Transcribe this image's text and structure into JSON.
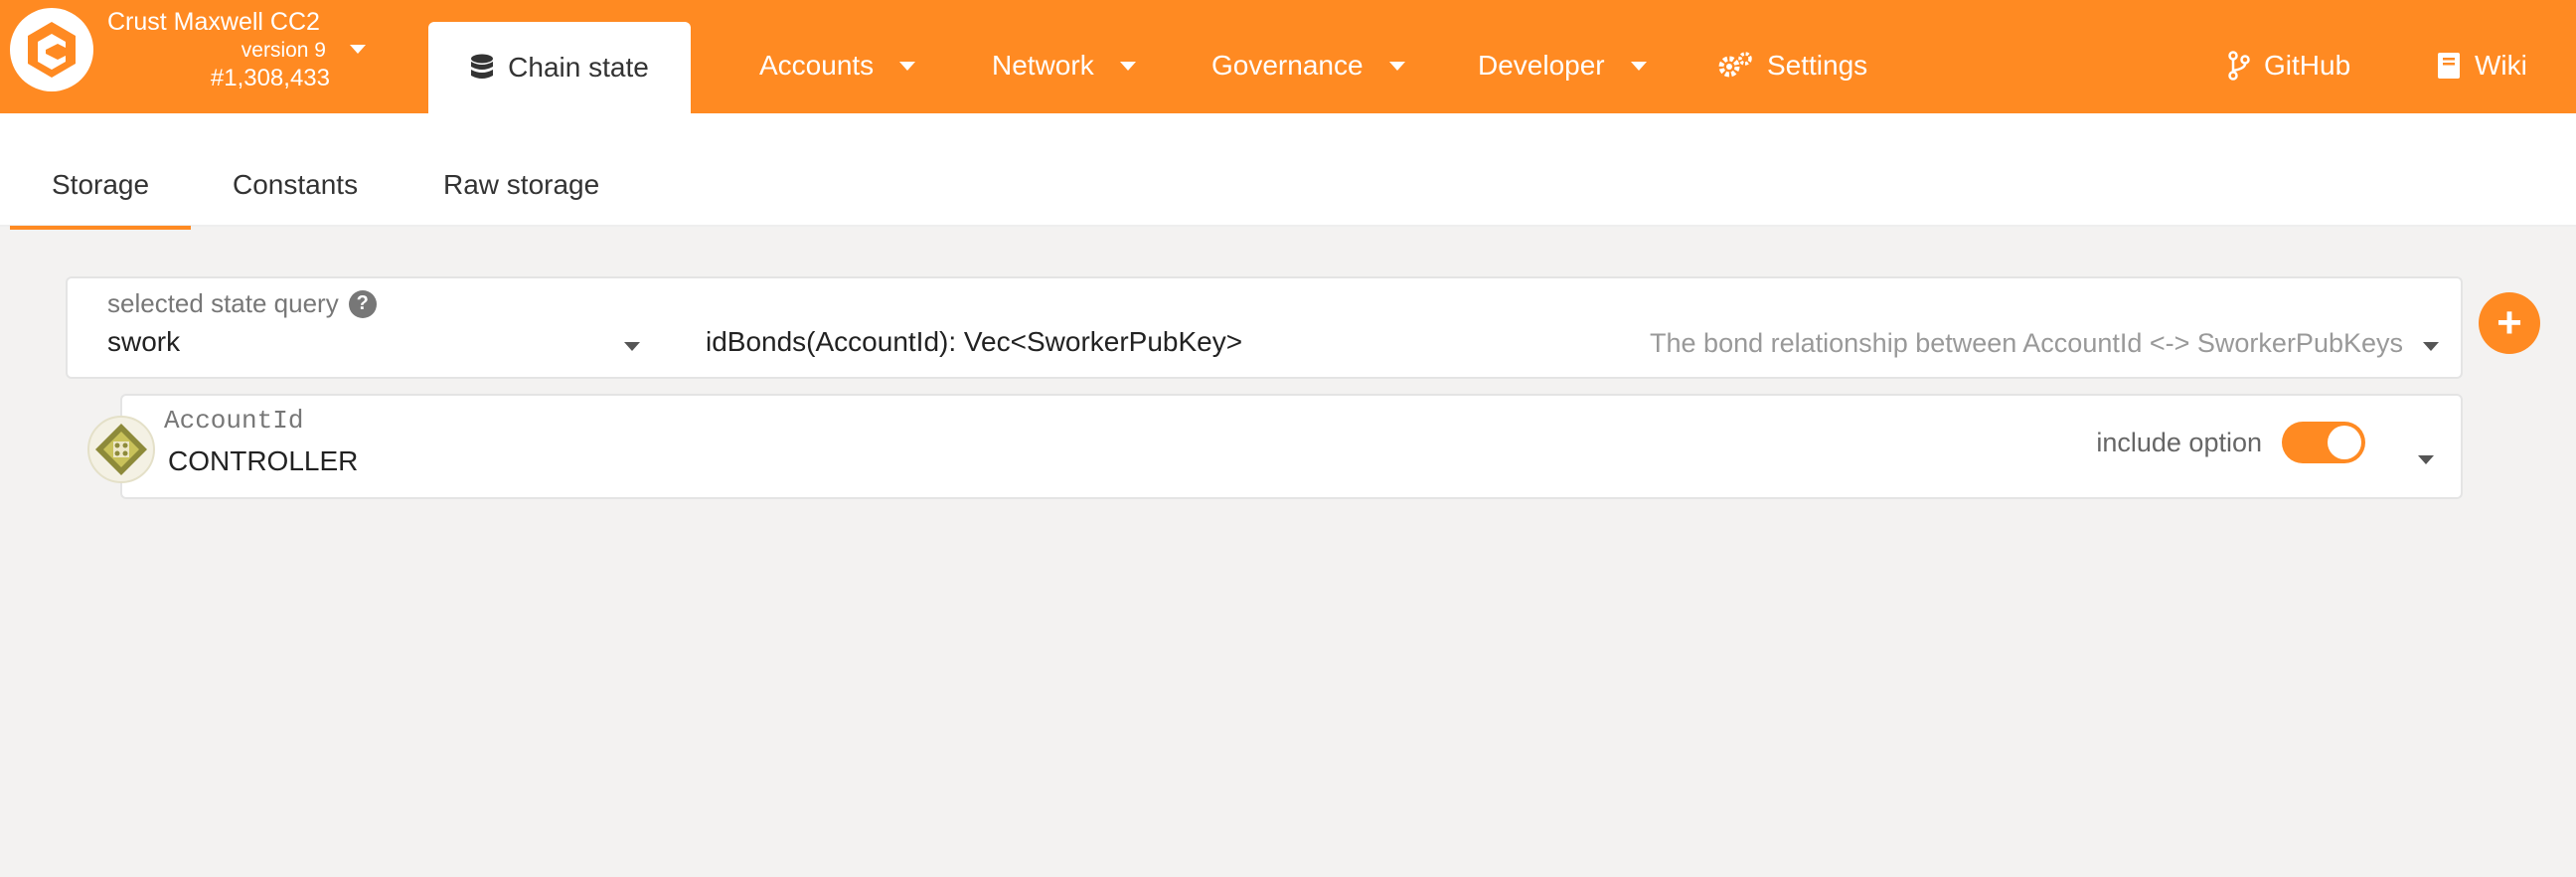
{
  "chain": {
    "name": "Crust Maxwell CC2",
    "version": "version 9",
    "block": "#1,308,433"
  },
  "nav": {
    "active": "Chain state",
    "items": [
      "Accounts",
      "Network",
      "Governance",
      "Developer"
    ],
    "settings": "Settings",
    "github": "GitHub",
    "wiki": "Wiki"
  },
  "subtabs": [
    "Storage",
    "Constants",
    "Raw storage"
  ],
  "query": {
    "label": "selected state query",
    "section": "swork",
    "method": "idBonds(AccountId): Vec<SworkerPubKey>",
    "description": "The bond relationship between AccountId <-> SworkerPubKeys"
  },
  "param": {
    "label": "AccountId",
    "value": "CONTROLLER",
    "option_label": "include option",
    "include_option": true
  },
  "colors": {
    "accent": "#ff8a22",
    "background": "#f3f2f1"
  }
}
